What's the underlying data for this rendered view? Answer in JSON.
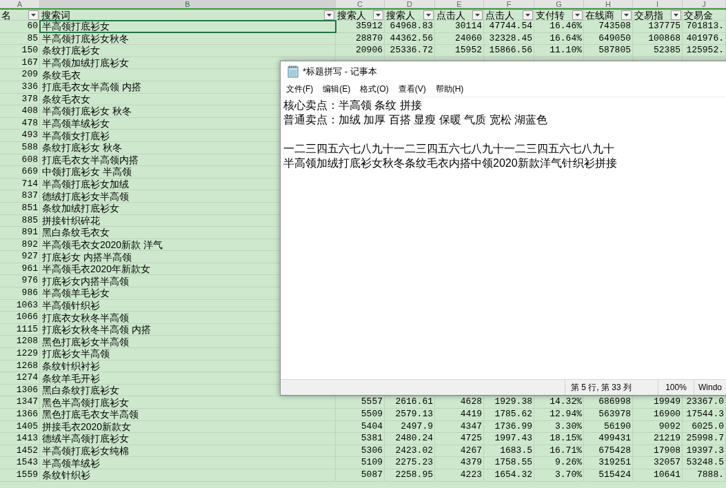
{
  "sheet": {
    "column_letters": [
      {
        "letter": "A",
        "selected": false
      },
      {
        "letter": "B",
        "selected": true
      },
      {
        "letter": "C",
        "selected": false
      },
      {
        "letter": "D",
        "selected": false
      },
      {
        "letter": "E",
        "selected": false
      },
      {
        "letter": "F",
        "selected": false
      },
      {
        "letter": "G",
        "selected": false
      },
      {
        "letter": "H",
        "selected": false
      },
      {
        "letter": "I",
        "selected": false
      },
      {
        "letter": "J",
        "selected": false
      }
    ],
    "header": [
      "名",
      "搜索词",
      "搜索人",
      "搜索人",
      "点击人",
      "点击人",
      "支付转",
      "在线商",
      "交易指",
      "交易金"
    ],
    "rows": [
      {
        "rank": "60",
        "keyword": "半高领打底衫女",
        "selected": true,
        "values": [
          "35912",
          "64968.83",
          "30114",
          "47744.54",
          "16.46%",
          "743508",
          "137775",
          "701813."
        ]
      },
      {
        "rank": "85",
        "keyword": "半高领打底衫女秋冬",
        "selected": false,
        "values": [
          "28870",
          "44362.56",
          "24060",
          "32328.45",
          "16.64%",
          "649050",
          "100868",
          "401976."
        ]
      },
      {
        "rank": "150",
        "keyword": "条纹打底衫女",
        "selected": false,
        "values": [
          "20906",
          "25336.72",
          "15952",
          "15866.56",
          "11.10%",
          "587805",
          "52385",
          "125952."
        ]
      },
      {
        "rank": "167",
        "keyword": "半高领加绒打底衫女",
        "selected": false
      },
      {
        "rank": "209",
        "keyword": "条纹毛衣",
        "selected": false
      },
      {
        "rank": "336",
        "keyword": "打底毛衣女半高领 内搭",
        "selected": false
      },
      {
        "rank": "378",
        "keyword": "条纹毛衣女",
        "selected": false
      },
      {
        "rank": "408",
        "keyword": "半高领打底衫女 秋冬",
        "selected": false
      },
      {
        "rank": "478",
        "keyword": "半高领羊绒衫女",
        "selected": false
      },
      {
        "rank": "493",
        "keyword": "半高领女打底衫",
        "selected": false
      },
      {
        "rank": "588",
        "keyword": "条纹打底衫女 秋冬",
        "selected": false
      },
      {
        "rank": "608",
        "keyword": "打底毛衣女半高领内搭",
        "selected": false
      },
      {
        "rank": "669",
        "keyword": "中领打底衫女 半高领",
        "selected": false
      },
      {
        "rank": "714",
        "keyword": "半高领打底衫女加绒",
        "selected": false
      },
      {
        "rank": "837",
        "keyword": "德绒打底衫女半高领",
        "selected": false
      },
      {
        "rank": "851",
        "keyword": "条纹加绒打底衫女",
        "selected": false
      },
      {
        "rank": "885",
        "keyword": "拼接针织碎花",
        "selected": false
      },
      {
        "rank": "891",
        "keyword": "黑白条纹毛衣女",
        "selected": false
      },
      {
        "rank": "892",
        "keyword": "半高领毛衣女2020新款 洋气",
        "selected": false
      },
      {
        "rank": "927",
        "keyword": "打底衫女 内搭半高领",
        "selected": false
      },
      {
        "rank": "961",
        "keyword": "半高领毛衣2020年新款女",
        "selected": false
      },
      {
        "rank": "976",
        "keyword": "打底衫女内搭半高领",
        "selected": false
      },
      {
        "rank": "986",
        "keyword": "半高领羊毛衫女",
        "selected": false
      },
      {
        "rank": "1063",
        "keyword": "半高领针织衫",
        "selected": false
      },
      {
        "rank": "1066",
        "keyword": "打底衣女秋冬半高领",
        "selected": false
      },
      {
        "rank": "1115",
        "keyword": "打底衫女秋冬半高领 内搭",
        "selected": false
      },
      {
        "rank": "1208",
        "keyword": "黑色打底衫女半高领",
        "selected": false
      },
      {
        "rank": "1229",
        "keyword": "打底衫女半高领",
        "selected": false
      },
      {
        "rank": "1268",
        "keyword": "条纹针织衬衫",
        "selected": false
      },
      {
        "rank": "1274",
        "keyword": "条纹羊毛开衫",
        "selected": false
      },
      {
        "rank": "1306",
        "keyword": "黑白条纹打底衫女",
        "selected": false
      },
      {
        "rank": "1347",
        "keyword": "黑色半高领打底衫女",
        "selected": false,
        "values": [
          "5557",
          "2616.61",
          "4628",
          "1929.38",
          "14.32%",
          "686998",
          "19949",
          "23367.0"
        ]
      },
      {
        "rank": "1366",
        "keyword": "黑色打底毛衣女半高领",
        "selected": false,
        "values": [
          "5509",
          "2579.13",
          "4419",
          "1785.62",
          "12.94%",
          "563978",
          "16900",
          "17544.3"
        ]
      },
      {
        "rank": "1405",
        "keyword": "拼接毛衣2020新款女",
        "selected": false,
        "values": [
          "5404",
          "2497.9",
          "4347",
          "1736.99",
          "3.30%",
          "56190",
          "9092",
          "6025.0"
        ]
      },
      {
        "rank": "1413",
        "keyword": "德绒半高领打底衫女",
        "selected": false,
        "values": [
          "5381",
          "2480.24",
          "4725",
          "1997.43",
          "18.15%",
          "499431",
          "21219",
          "25998.7"
        ]
      },
      {
        "rank": "1452",
        "keyword": "半高领打底衫女纯棉",
        "selected": false,
        "values": [
          "5306",
          "2423.02",
          "4267",
          "1683.5",
          "16.71%",
          "675428",
          "17908",
          "19397.3"
        ]
      },
      {
        "rank": "1543",
        "keyword": "半高领羊绒衫",
        "selected": false,
        "values": [
          "5109",
          "2275.23",
          "4379",
          "1758.55",
          "9.26%",
          "319251",
          "32057",
          "53248.5"
        ]
      },
      {
        "rank": "1559",
        "keyword": "条纹针织衫",
        "selected": false,
        "values": [
          "5087",
          "2258.95",
          "4223",
          "1654.32",
          "3.70%",
          "515424",
          "10641",
          "7888."
        ]
      }
    ]
  },
  "notepad": {
    "title": "*标题拼写 - 记事本",
    "menu": [
      "文件(F)",
      "编辑(E)",
      "格式(O)",
      "查看(V)",
      "帮助(H)"
    ],
    "blocks": [
      [
        "核心卖点：半高领 条纹 拼接",
        "普通卖点：加绒 加厚 百搭 显瘦 保暖 气质 宽松 湖蓝色"
      ],
      [
        "一二三四五六七八九十一二三四五六七八九十一二三四五六七八九十",
        "半高领加绒打底衫女秋冬条纹毛衣内搭中领2020新款洋气针织衫拼接"
      ]
    ],
    "status": {
      "position": "第 5 行, 第 33 列",
      "zoom": "100%",
      "encoding": "Windo"
    }
  }
}
